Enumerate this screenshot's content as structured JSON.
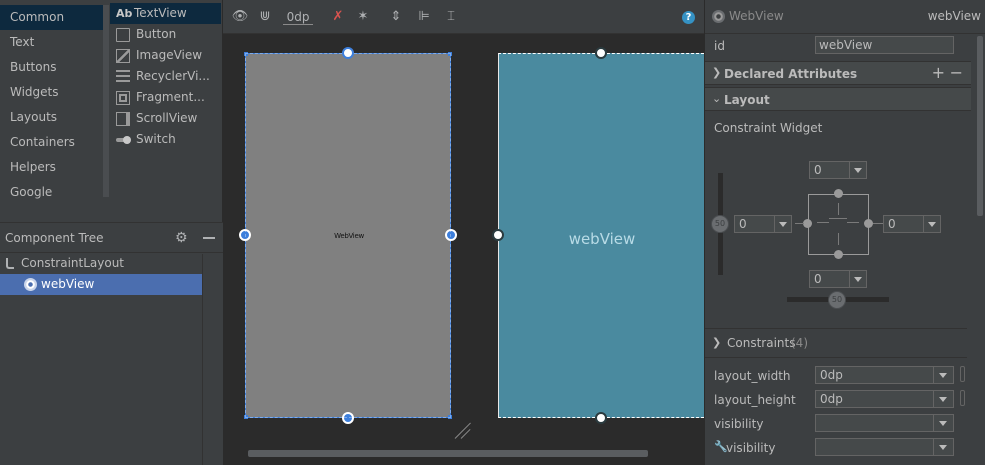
{
  "palette": {
    "categories": [
      "Common",
      "Text",
      "Buttons",
      "Widgets",
      "Layouts",
      "Containers",
      "Helpers",
      "Google"
    ],
    "items": [
      {
        "label": "TextView",
        "icon": "text-view-icon"
      },
      {
        "label": "Button",
        "icon": "button-icon"
      },
      {
        "label": "ImageView",
        "icon": "image-view-icon"
      },
      {
        "label": "RecyclerVi...",
        "icon": "recycler-view-icon"
      },
      {
        "label": "Fragment...",
        "icon": "fragment-icon"
      },
      {
        "label": "ScrollView",
        "icon": "scroll-view-icon"
      },
      {
        "label": "Switch",
        "icon": "switch-icon"
      }
    ],
    "textview_prefix": "Ab"
  },
  "tree": {
    "title": "Component Tree",
    "nodes": [
      {
        "label": "ConstraintLayout"
      },
      {
        "label": "webView"
      }
    ]
  },
  "toolbar": {
    "margin_value": "0dp",
    "help": "?"
  },
  "canvas": {
    "design_label": "WebView",
    "blueprint_label": "webView",
    "accent": "#3d7fdc",
    "blueprint_color": "#4a8a9f"
  },
  "attributes": {
    "type": "WebView",
    "id_display": "webView",
    "id_label": "id",
    "id_value": "webView",
    "declared_title": "Declared Attributes",
    "layout_title": "Layout",
    "constraint_widget_title": "Constraint Widget",
    "margin_top": "0",
    "margin_left": "0",
    "margin_right": "0",
    "margin_bottom": "0",
    "bias_vertical": "50",
    "bias_horizontal": "50",
    "constraints_title": "Constraints",
    "constraints_count": "(4)",
    "layout_width_label": "layout_width",
    "layout_width_value": "0dp",
    "layout_height_label": "layout_height",
    "layout_height_value": "0dp",
    "visibility_label": "visibility",
    "visibility_value": "",
    "tools_visibility_label": "visibility",
    "tools_visibility_value": ""
  }
}
